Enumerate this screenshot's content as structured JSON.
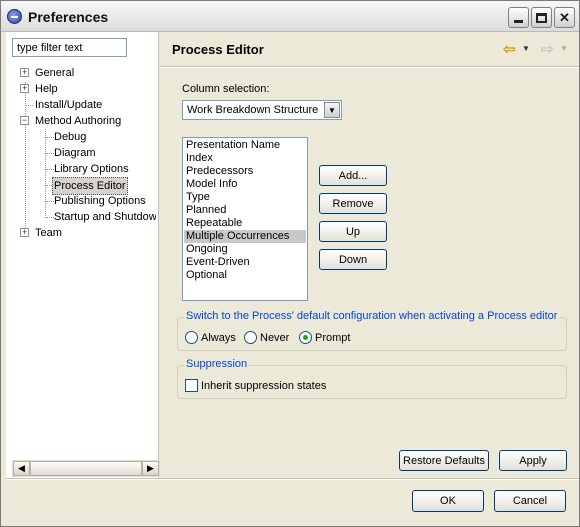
{
  "window": {
    "title": "Preferences",
    "app_icon": "eclipse-icon",
    "controls": [
      "minimize-icon",
      "maximize-icon",
      "close-icon"
    ]
  },
  "sidebar": {
    "filter_value": "type filter text",
    "tree": [
      {
        "label": "General",
        "expander": "+"
      },
      {
        "label": "Help",
        "expander": "+"
      },
      {
        "label": "Install/Update",
        "expander": ""
      },
      {
        "label": "Method Authoring",
        "expander": "−"
      },
      {
        "label": "Debug"
      },
      {
        "label": "Diagram"
      },
      {
        "label": "Library Options"
      },
      {
        "label": "Process Editor",
        "selected": true
      },
      {
        "label": "Publishing Options"
      },
      {
        "label": "Startup and Shutdown"
      },
      {
        "label": "Team",
        "expander": "+"
      }
    ],
    "scroll_left": "◀",
    "scroll_right": "▶"
  },
  "page": {
    "title": "Process Editor",
    "nav_back": "⇦",
    "nav_back_drop": "▼",
    "nav_fwd": "⇨",
    "nav_fwd_drop": "▼",
    "column_selection_label": "Column selection:",
    "column_selection_value": "Work Breakdown Structure",
    "combo_arrow": "▼",
    "columns": [
      "Presentation Name",
      "Index",
      "Predecessors",
      "Model Info",
      "Type",
      "Planned",
      "Repeatable",
      "Multiple Occurrences",
      "Ongoing",
      "Event-Driven",
      "Optional"
    ],
    "selected_column": "Multiple Occurrences",
    "buttons": {
      "add": "Add...",
      "remove": "Remove",
      "up": "Up",
      "down": "Down"
    },
    "switch_group": {
      "legend": "Switch to the Process' default configuration when activating a Process editor",
      "options": [
        "Always",
        "Never",
        "Prompt"
      ],
      "selected": "Prompt"
    },
    "suppression_group": {
      "legend": "Suppression",
      "checkbox_label": "Inherit suppression states",
      "checked": false
    },
    "restore_defaults": "Restore Defaults",
    "apply": "Apply"
  },
  "footer": {
    "ok": "OK",
    "cancel": "Cancel"
  },
  "colors": {
    "window_bg": "#ece9d8",
    "accent_blue": "#0046d5",
    "list_selection": "#c8c8c8"
  }
}
